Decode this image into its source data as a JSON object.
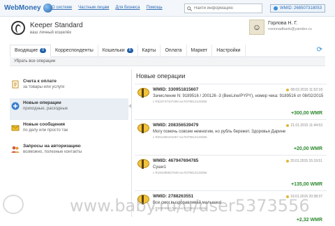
{
  "header": {
    "logo_text": "WebMoney",
    "nav": [
      "О системе",
      "Частным лицам",
      "Для бизнеса",
      "Помощь"
    ],
    "search_placeholder": "Найти информацию",
    "wmid_label": "WMID: 268507318053"
  },
  "keeper": {
    "title": "Keeper Standard",
    "subtitle": "ваш личный кошелёк"
  },
  "user": {
    "name": "Горлова Н. Г.",
    "email": "rosinnadbank@yandex.ru"
  },
  "tabs": [
    {
      "label": "Входящие",
      "badge": "8"
    },
    {
      "label": "Корреспонденты",
      "badge": ""
    },
    {
      "label": "Кошельки",
      "badge": "8"
    },
    {
      "label": "Карты",
      "badge": ""
    },
    {
      "label": "Оплата",
      "badge": ""
    },
    {
      "label": "Маркет",
      "badge": ""
    },
    {
      "label": "Настройки",
      "badge": ""
    }
  ],
  "subbar_text": "Убрать все операции",
  "sidebar": [
    {
      "title": "Счета к оплате",
      "sub": "за товары или услуги",
      "color": "#e8a832"
    },
    {
      "title": "Новые операции",
      "sub": "приходные, расходные",
      "color": "#3a7fcf"
    },
    {
      "title": "Новые сообщения",
      "sub": "по делу или просто так",
      "color": "#f0c030"
    },
    {
      "title": "Запросы на авторизацию",
      "sub": "возможно, полезные контакты",
      "color": "#d45a3a"
    }
  ],
  "main_title": "Новые операции",
  "operations": [
    {
      "wmid": "WMID: 330951815607",
      "date": "08.02.2015 11:52:18",
      "desc": "Зачисление N: 9189516 / 200126 -3 (BeeLine/PYPY), номер чека: 9189516 от 08/02/2015",
      "route": "с R323747107408 на R379612126356",
      "amount": "+300,00 WMR"
    },
    {
      "wmid": "WMID: 208356539479",
      "date": "21.01.2015 11:44:53",
      "desc": "Могу помочь совсем немногим, но рубль бережет. Здоровья Дарине",
      "route": "с R251365101067 на R379612126356",
      "amount": "+20,00 WMR"
    },
    {
      "wmid": "WMID: 467947694785",
      "date": "20.01.2015 15:19:51",
      "desc": "Суши1",
      "route": "с R194498627639 на R379612126356",
      "amount": "+135,00 WMR"
    },
    {
      "wmid": "WMID: 2788263551",
      "date": "19.01.2015 20:38:37",
      "desc": "Все смог,выздоравливай,малышка!",
      "route": "с R309098517581 на R379612126356",
      "amount": "+2,32 WMR"
    }
  ],
  "watermark": "www.baby.ru/u/user5373556"
}
